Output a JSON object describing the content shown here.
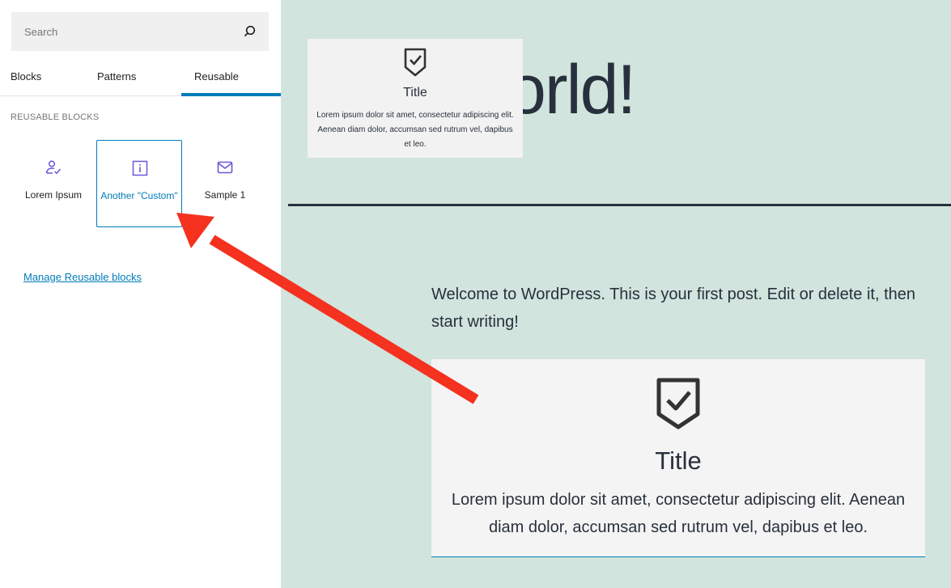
{
  "inserter": {
    "search": {
      "placeholder": "Search",
      "value": ""
    },
    "tabs": [
      {
        "label": "Blocks",
        "active": false
      },
      {
        "label": "Patterns",
        "active": false
      },
      {
        "label": "Reusable",
        "active": true
      }
    ],
    "section_heading": "Reusable blocks",
    "reusable_blocks": [
      {
        "label": "Lorem Ipsum",
        "icon": "person-check-icon",
        "selected": false
      },
      {
        "label": "Another \"Custom\"",
        "icon": "info-icon",
        "selected": true
      },
      {
        "label": "Sample 1",
        "icon": "envelope-icon",
        "selected": false
      }
    ],
    "manage_link": "Manage Reusable blocks"
  },
  "preview": {
    "icon": "shield-check-icon",
    "title": "Title",
    "body": "Lorem ipsum dolor sit amet, consectetur adipiscing elit. Aenean diam dolor, accumsan sed rutrum vel, dapibus et leo."
  },
  "editor": {
    "post_title_visible": "orld!",
    "intro_text": "Welcome to WordPress. This is your first post. Edit or delete it, then start writing!",
    "content_block": {
      "icon": "shield-check-icon",
      "title": "Title",
      "body": "Lorem ipsum dolor sit amet, consectetur adipiscing elit. Aenean diam dolor, accumsan sed rutrum vel, dapibus et leo."
    }
  },
  "colors": {
    "accent": "#007cba",
    "canvas_background": "#d1e4dd",
    "card_background": "#f4f4f4",
    "text_dark": "#28303d",
    "icon_purple": "#6b55d9",
    "annotation_arrow": "#f5311f"
  }
}
